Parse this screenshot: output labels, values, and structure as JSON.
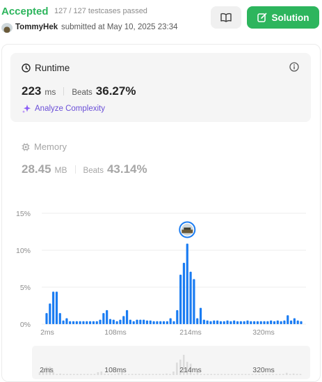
{
  "header": {
    "status": "Accepted",
    "testcases": "127 / 127 testcases passed",
    "username": "TommyHek",
    "submitted": "submitted at May 10, 2025 23:34",
    "solution_label": "Solution"
  },
  "runtime": {
    "title": "Runtime",
    "value": "223",
    "unit": "ms",
    "beats_label": "Beats",
    "beats_value": "36.27%",
    "analyze_label": "Analyze Complexity"
  },
  "memory": {
    "title": "Memory",
    "value": "28.45",
    "unit": "MB",
    "beats_label": "Beats",
    "beats_value": "43.14%"
  },
  "colors": {
    "accepted": "#2db55d",
    "bar": "#1a7cf2",
    "analyze": "#6b4fd8"
  },
  "chart_data": {
    "type": "bar",
    "y_ticks": [
      "15%",
      "10%",
      "5%",
      "0%"
    ],
    "x_ticks": [
      "2ms",
      "108ms",
      "214ms",
      "320ms"
    ],
    "ylim": [
      0,
      15
    ],
    "values": [
      1.5,
      2.8,
      4.4,
      4.4,
      1.5,
      0.5,
      0.8,
      0.4,
      0.4,
      0.4,
      0.4,
      0.4,
      0.4,
      0.4,
      0.4,
      0.4,
      0.6,
      1.5,
      1.9,
      0.7,
      0.6,
      0.4,
      0.6,
      1.1,
      1.9,
      0.6,
      0.4,
      0.6,
      0.6,
      0.6,
      0.5,
      0.5,
      0.4,
      0.4,
      0.4,
      0.4,
      0.4,
      0.8,
      0.4,
      1.9,
      6.7,
      8.3,
      10.9,
      7.1,
      6.1,
      0.8,
      2.2,
      0.6,
      0.5,
      0.4,
      0.5,
      0.5,
      0.4,
      0.4,
      0.5,
      0.4,
      0.5,
      0.4,
      0.4,
      0.4,
      0.5,
      0.4,
      0.4,
      0.4,
      0.4,
      0.4,
      0.4,
      0.5,
      0.4,
      0.5,
      0.4,
      0.5,
      1.2,
      0.5,
      0.8,
      0.5,
      0.4
    ],
    "highlight_index": 42
  }
}
